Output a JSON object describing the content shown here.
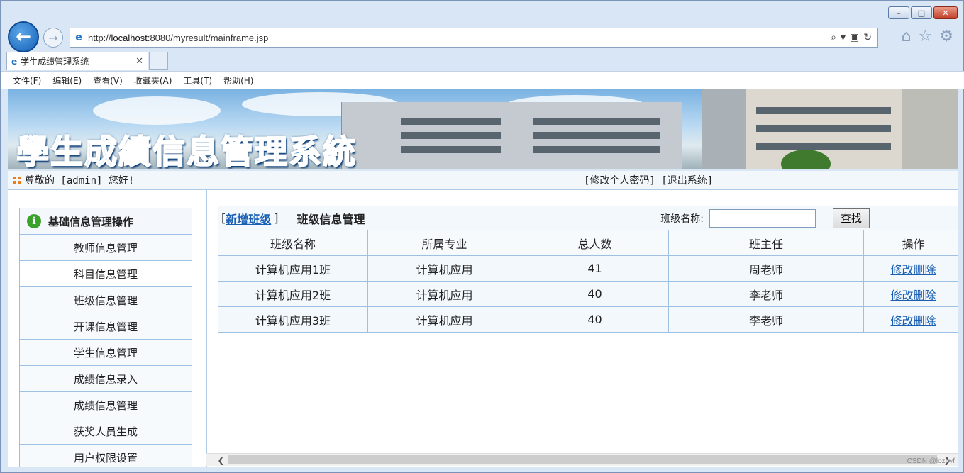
{
  "browser": {
    "url_prefix": "http://",
    "url_host": "localhost",
    "url_rest": ":8080/myresult/mainframe.jsp",
    "tab_title": "学生成绩管理系统",
    "menu": [
      "文件(F)",
      "编辑(E)",
      "查看(V)",
      "收藏夹(A)",
      "工具(T)",
      "帮助(H)"
    ]
  },
  "banner": {
    "title": "學生成績信息管理系統"
  },
  "user_bar": {
    "greeting": "尊敬的 [admin] 您好!",
    "links": "[修改个人密码] [退出系统]"
  },
  "sidebar": {
    "header": "基础信息管理操作",
    "items": [
      "教师信息管理",
      "科目信息管理",
      "班级信息管理",
      "开课信息管理",
      "学生信息管理",
      "成绩信息录入",
      "成绩信息管理",
      "获奖人员生成",
      "用户权限设置"
    ]
  },
  "main": {
    "add_link": "新增班级",
    "title": "班级信息管理",
    "search_label": "班级名称:",
    "search_value": "",
    "search_button": "查找",
    "columns": [
      "班级名称",
      "所属专业",
      "总人数",
      "班主任",
      "操作"
    ],
    "rows": [
      {
        "name": "计算机应用1班",
        "major": "计算机应用",
        "count": "41",
        "teacher": "周老师",
        "edit": "修改",
        "delete": "删除"
      },
      {
        "name": "计算机应用2班",
        "major": "计算机应用",
        "count": "40",
        "teacher": "李老师",
        "edit": "修改",
        "delete": "删除"
      },
      {
        "name": "计算机应用3班",
        "major": "计算机应用",
        "count": "40",
        "teacher": "李老师",
        "edit": "修改",
        "delete": "删除"
      }
    ]
  },
  "watermark": "CSDN @lozhyf"
}
